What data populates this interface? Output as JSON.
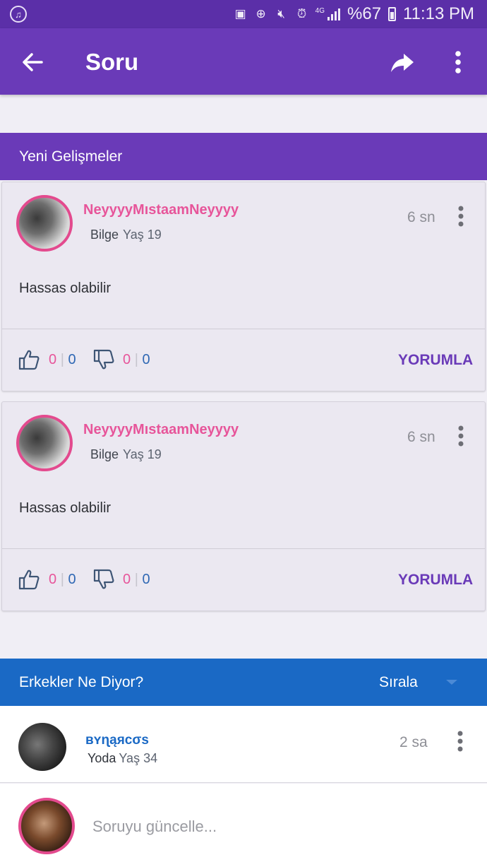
{
  "status_bar": {
    "battery_percent": "%67",
    "time": "11:13 PM",
    "network": "4G"
  },
  "app_bar": {
    "title": "Soru",
    "icons": [
      "arrow-back-icon",
      "share-icon",
      "more-vert-icon"
    ]
  },
  "updates_section": {
    "title": "Yeni Gelişmeler"
  },
  "updates": [
    {
      "username": "NeyyyyMıstaamNeyyyy",
      "badge": "Bilge",
      "age": "Yaş 19",
      "time": "6 sn",
      "text": "Hassas olabilir",
      "likes_female": "0",
      "likes_male": "0",
      "dislikes_female": "0",
      "dislikes_male": "0",
      "comment_label": "YORUMLA"
    },
    {
      "username": "NeyyyyMıstaamNeyyyy",
      "badge": "Bilge",
      "age": "Yaş 19",
      "time": "6 sn",
      "text": "Hassas olabilir",
      "likes_female": "0",
      "likes_male": "0",
      "dislikes_female": "0",
      "dislikes_male": "0",
      "comment_label": "YORUMLA"
    }
  ],
  "men_section": {
    "title": "Erkekler Ne Diyor?",
    "sort_label": "Sırala"
  },
  "answer": {
    "username": "ʙʏɳąяcσs",
    "badge": "Yoda",
    "age": "Yaş 34",
    "time": "2 sa"
  },
  "update_input": {
    "placeholder": "Soruyu güncelle..."
  },
  "colors": {
    "purple_dark": "#5b2fa8",
    "purple": "#6a3ab8",
    "pink": "#e7559a",
    "blue": "#1a69c5"
  }
}
